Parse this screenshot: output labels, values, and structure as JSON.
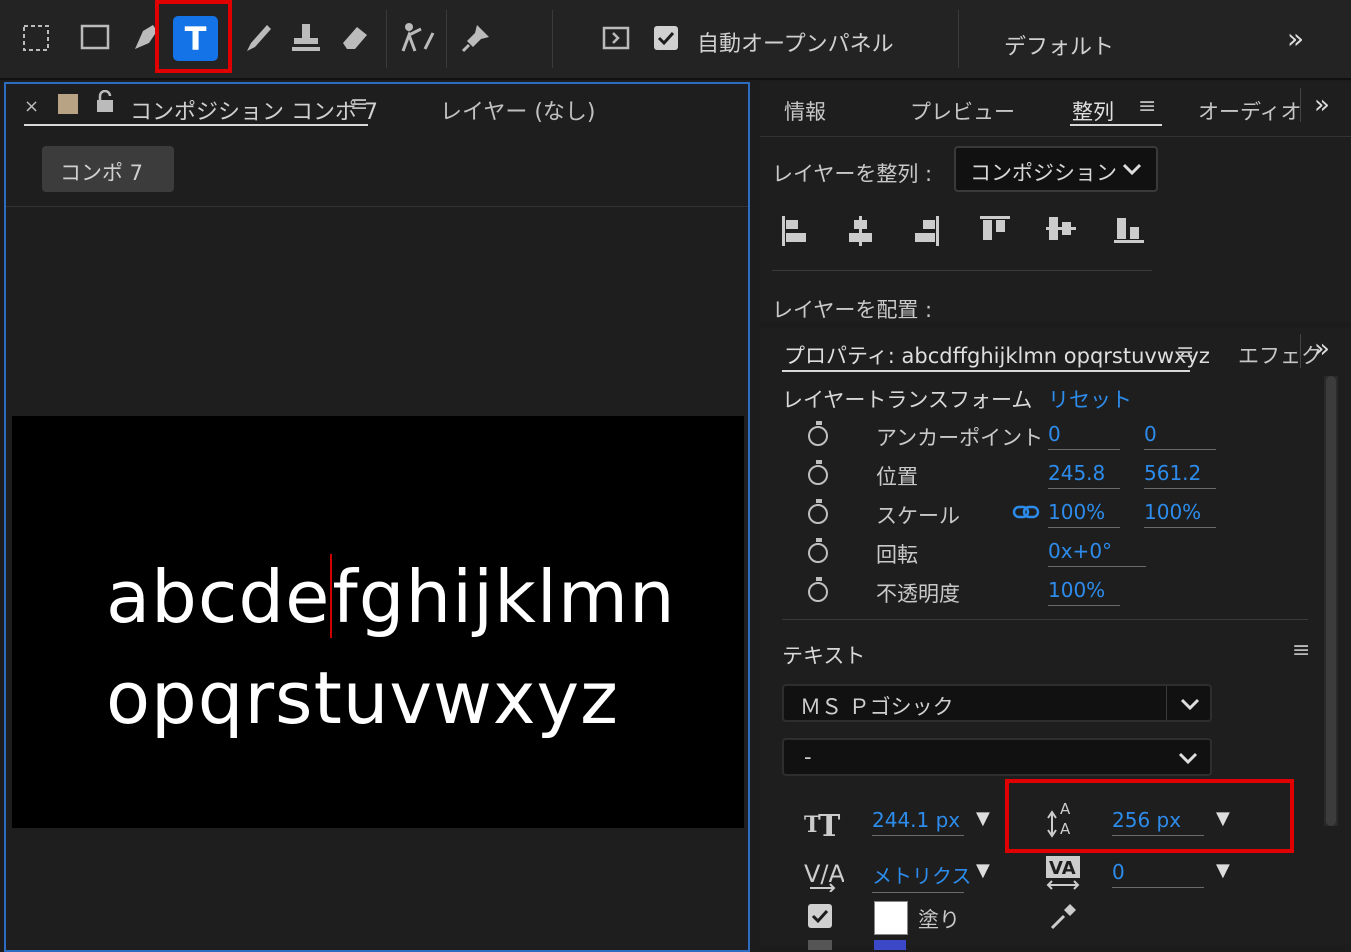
{
  "toolbar": {
    "auto_open_label": "自動オープンパネル",
    "workspace_label": "デフォルト",
    "overflow": "»",
    "text_tool": "T"
  },
  "comp_panel": {
    "close": "×",
    "tab_title": "コンポジション コンポ 7",
    "menu": "≡",
    "layer_tab": "レイヤー (なし)",
    "breadcrumb": "コンポ 7",
    "text_line1_before": "abcde",
    "text_line1_after": "fghijklmn",
    "text_line2": "opqrstuvwxyz"
  },
  "align_panel": {
    "tabs": [
      "情報",
      "プレビュー",
      "整列",
      "オーディオ"
    ],
    "active_tab": "整列",
    "menu": "≡",
    "overflow": "»",
    "align_to_label": "レイヤーを整列 :",
    "align_to_value": "コンポジション",
    "distribute_label": "レイヤーを配置 :"
  },
  "properties": {
    "tab_title": "プロパティ: abcdffghijklmn opqrstuvwxyz",
    "menu": "≡",
    "effects_tab": "エフェク",
    "overflow": "»",
    "transform_label": "レイヤートランスフォーム",
    "reset": "リセット",
    "rows": [
      {
        "label": "アンカーポイント",
        "v1": "0",
        "v2": "0"
      },
      {
        "label": "位置",
        "v1": "245.8",
        "v2": "561.2"
      },
      {
        "label": "スケール",
        "v1": "100%",
        "v2": "100%"
      },
      {
        "label": "回転",
        "v1": "0x+0°",
        "v2": ""
      },
      {
        "label": "不透明度",
        "v1": "100%",
        "v2": ""
      }
    ],
    "text_section": "テキスト",
    "font_family": "ＭＳ Ｐゴシック",
    "font_style": "-",
    "font_size": "244.1 px",
    "leading": "256 px",
    "kerning": "メトリクス",
    "tracking": "0",
    "fill_label": "塗り"
  },
  "colors": {
    "accent": "#1473e6",
    "value_blue": "#2d8ceb",
    "highlight": "#e00000",
    "panel_bg": "#1e1e1e",
    "comp_swatch": "#b8a484"
  }
}
